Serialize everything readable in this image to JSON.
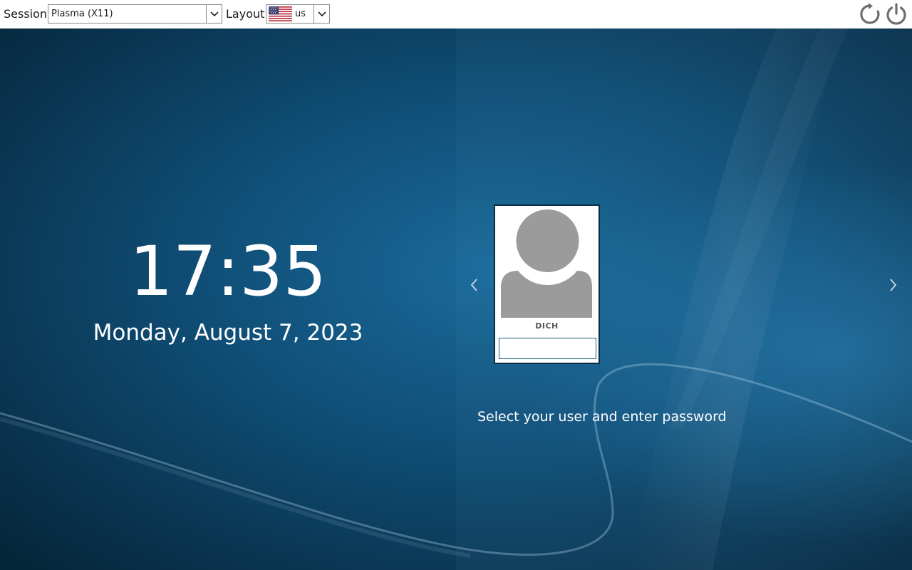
{
  "topbar": {
    "session_label": "Session",
    "session_value": "Plasma (X11)",
    "layout_label": "Layout",
    "layout_value": "us",
    "layout_flag_icon": "us-flag-icon",
    "reboot_icon": "reboot-icon",
    "shutdown_icon": "power-icon"
  },
  "clock": {
    "time": "17:35",
    "date": "Monday, August 7, 2023"
  },
  "user": {
    "name": "DICH",
    "avatar_icon": "user-silhouette-icon",
    "password_value": ""
  },
  "navigation": {
    "prev_icon": "chevron-left-icon",
    "next_icon": "chevron-right-icon"
  },
  "hint": "Select your user and enter password",
  "colors": {
    "background_dark": "#06263a",
    "background_mid": "#0f5079",
    "background_light": "#1f6d9c",
    "topbar": "#ffffff",
    "text_on_bg": "#ffffff",
    "avatar_gray": "#9b9b9b",
    "input_border": "#1d5b83"
  }
}
